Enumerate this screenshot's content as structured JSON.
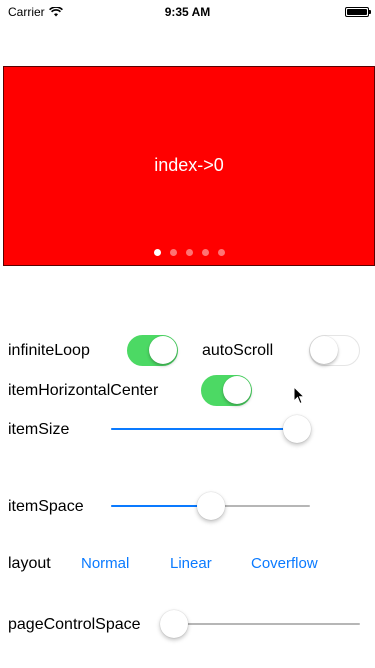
{
  "status_bar": {
    "carrier": "Carrier",
    "time": "9:35 AM"
  },
  "banner": {
    "text": "index->0",
    "background": "#ff0000",
    "page_count": 5,
    "current_page": 0
  },
  "controls": {
    "infinite_loop": {
      "label": "infiniteLoop",
      "on": true
    },
    "auto_scroll": {
      "label": "autoScroll",
      "on": false
    },
    "item_horizontal_center": {
      "label": "itemHorizontalCenter",
      "on": true
    },
    "item_size": {
      "label": "itemSize",
      "value": 1.0
    },
    "item_space": {
      "label": "itemSpace",
      "value": 0.5
    },
    "layout": {
      "label": "layout",
      "options": [
        "Normal",
        "Linear",
        "Coverflow"
      ]
    },
    "page_control_space": {
      "label": "pageControlSpace",
      "value": 0.0
    }
  },
  "colors": {
    "accent": "#0a7aff",
    "switch_on": "#4cd964"
  }
}
